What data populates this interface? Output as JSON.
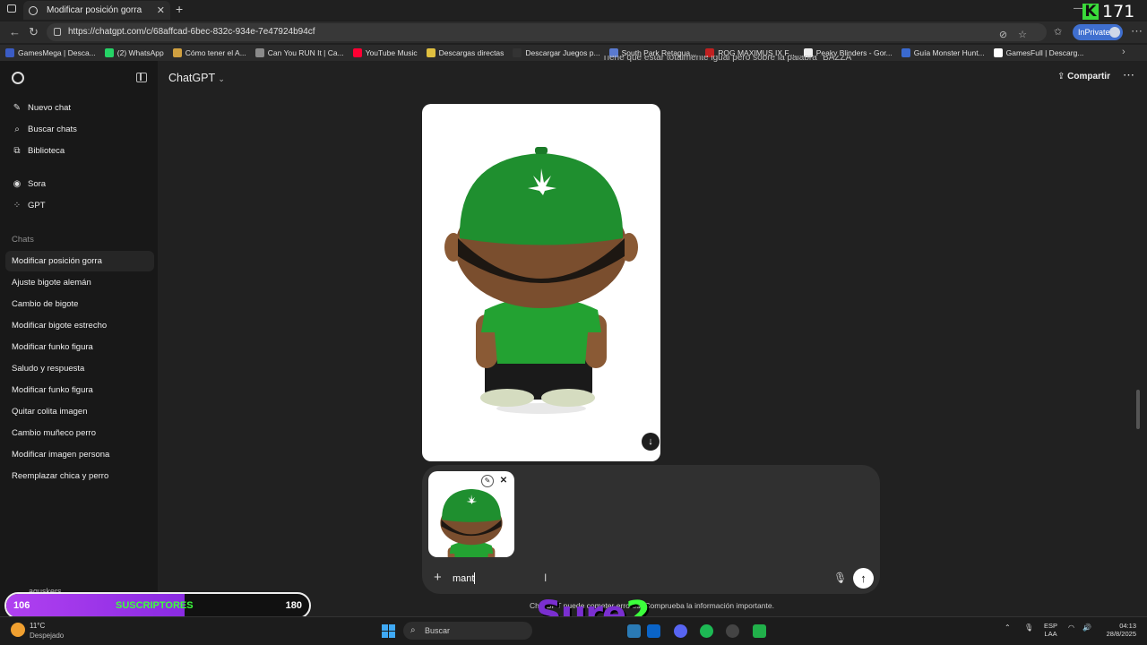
{
  "browser": {
    "tab_title": "Modificar posición gorra",
    "url": "https://chatgpt.com/c/68affcad-6bec-832c-934e-7e47924b94cf",
    "inprivate_label": "InPrivate",
    "bookmarks": [
      {
        "label": "GamesMega | Desca...",
        "color": "#3b5cc4"
      },
      {
        "label": "(2) WhatsApp",
        "color": "#25d366"
      },
      {
        "label": "Cómo tener el A...",
        "color": "#d0a040"
      },
      {
        "label": "Can You RUN It | Ca...",
        "color": "#8a8a8a"
      },
      {
        "label": "YouTube Music",
        "color": "#ff0033"
      },
      {
        "label": "Descargas directas",
        "color": "#e0c040"
      },
      {
        "label": "Descargar Juegos p...",
        "color": "#333333"
      },
      {
        "label": "South Park Retagua...",
        "color": "#5a7ad0"
      },
      {
        "label": "ROG MAXIMUS IX F...",
        "color": "#c02020"
      },
      {
        "label": "Peaky Blinders - Gor...",
        "color": "#eeeeee"
      },
      {
        "label": "Guía Monster Hunt...",
        "color": "#3a6ad0"
      },
      {
        "label": "GamesFull | Descarg...",
        "color": "#ffffff"
      }
    ]
  },
  "overlay": {
    "k_logo": "K",
    "k_count": "171",
    "subs_current": "106",
    "subs_label": "SUSCRIPTORES",
    "subs_goal": "180",
    "subs_fraction": 0.589,
    "brand_a": "Sure",
    "brand_b": "2"
  },
  "sidebar": {
    "top_items": [
      {
        "label": "Nuevo chat",
        "icon": "edit-icon"
      },
      {
        "label": "Buscar chats",
        "icon": "search-icon"
      },
      {
        "label": "Biblioteca",
        "icon": "library-icon"
      }
    ],
    "tool_items": [
      {
        "label": "Sora",
        "icon": "sora-icon"
      },
      {
        "label": "GPT",
        "icon": "gpt-grid-icon"
      }
    ],
    "section_label": "Chats",
    "chats": [
      "Modificar posición gorra",
      "Ajuste bigote alemán",
      "Cambio de bigote",
      "Modificar bigote estrecho",
      "Modificar funko figura",
      "Saludo y respuesta",
      "Modificar funko figura",
      "Quitar colita imagen",
      "Cambio muñeco perro",
      "Modificar imagen persona",
      "Reemplazar chica y perro"
    ],
    "user_label": "aguskers"
  },
  "header": {
    "title": "ChatGPT",
    "share_label": "Compartir",
    "cut_text": "Tiene que estar totalmente igual pero sobre la palabra \"BAZZA\""
  },
  "composer": {
    "input_value": "mant",
    "disclaimer": "ChatGPT puede cometer errores. Comprueba la información importante."
  },
  "colors": {
    "cap_green": "#1f8f2f",
    "shirt_green": "#23a232",
    "skin": "#8a5a35",
    "pants": "#1a1a1a"
  },
  "taskbar": {
    "temp": "11°C",
    "weather": "Despejado",
    "search_label": "Buscar",
    "lang_top": "ESP",
    "lang_bottom": "LAA",
    "time": "04:13",
    "date": "28/8/2025"
  }
}
